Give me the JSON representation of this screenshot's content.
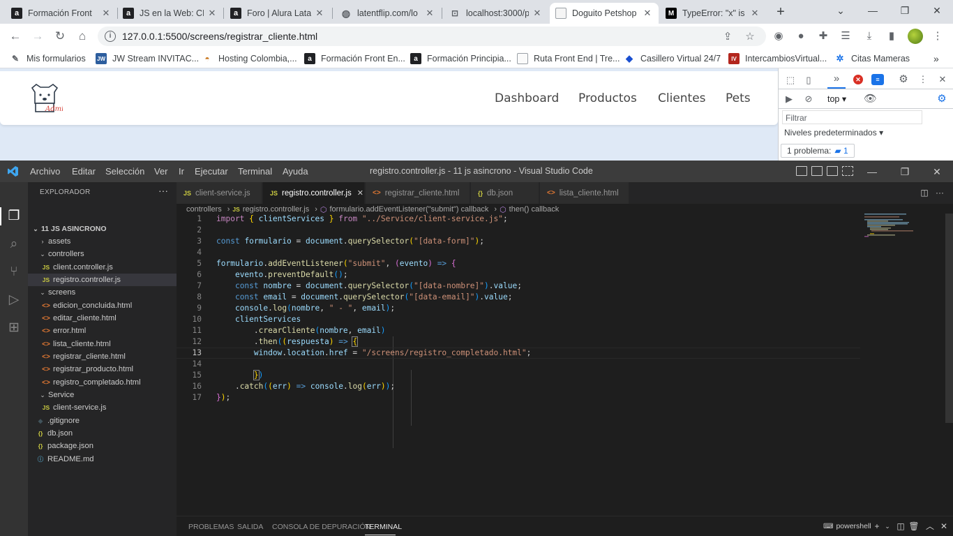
{
  "browser": {
    "tabs": [
      {
        "title": "Formación Front",
        "favicon": "alura-icon"
      },
      {
        "title": "JS en la Web: CRU",
        "favicon": "alura-icon"
      },
      {
        "title": "Foro | Alura Latar",
        "favicon": "alura-icon"
      },
      {
        "title": "latentflip.com/lo",
        "favicon": "globe-icon"
      },
      {
        "title": "localhost:3000/p",
        "favicon": "server-icon"
      },
      {
        "title": "Doguito Petshop",
        "favicon": "page-icon"
      },
      {
        "title": "TypeError: \"x\" is r",
        "favicon": "mdn-icon"
      }
    ],
    "active_tab_index": 5,
    "url": "127.0.0.1:5500/screens/registrar_cliente.html",
    "bookmarks": [
      {
        "label": "Mis formularios",
        "icon": "edit-icon"
      },
      {
        "label": "JW Stream INVITAC...",
        "icon": "jw-icon"
      },
      {
        "label": "Hosting Colombia,...",
        "icon": "hosting-icon"
      },
      {
        "label": "Formación Front En...",
        "icon": "alura-icon"
      },
      {
        "label": "Formación Principia...",
        "icon": "alura-icon"
      },
      {
        "label": "Ruta Front End | Tre...",
        "icon": "page-icon"
      },
      {
        "label": "Casillero Virtual 24/7",
        "icon": "diamond-icon"
      },
      {
        "label": "IntercambiosVirtual...",
        "icon": "iv-icon"
      },
      {
        "label": "Citas Mameras",
        "icon": "molecule-icon"
      }
    ]
  },
  "site": {
    "logo_text": "Admin",
    "nav": [
      "Dashboard",
      "Productos",
      "Clientes",
      "Pets"
    ]
  },
  "devtools": {
    "context": "top",
    "filter_placeholder": "Filtrar",
    "levels": "Niveles predeterminados",
    "problems_label": "1 problema:",
    "problems_count": "1",
    "error_count": "",
    "message_count": ""
  },
  "vscode": {
    "menu": [
      "Archivo",
      "Editar",
      "Selección",
      "Ver",
      "Ir",
      "Ejecutar",
      "Terminal",
      "Ayuda"
    ],
    "window_title": "registro.controller.js - 11 js asincrono - Visual Studio Code",
    "explorer_title": "EXPLORADOR",
    "tree": [
      {
        "label": "11 JS ASINCRONO",
        "kind": "root-open",
        "depth": 0
      },
      {
        "label": "assets",
        "kind": "folder-closed",
        "depth": 1
      },
      {
        "label": "controllers",
        "kind": "folder-open",
        "depth": 1
      },
      {
        "label": "client.controller.js",
        "kind": "js",
        "depth": 2
      },
      {
        "label": "registro.controller.js",
        "kind": "js",
        "depth": 2,
        "selected": true
      },
      {
        "label": "screens",
        "kind": "folder-open",
        "depth": 1
      },
      {
        "label": "edicion_concluida.html",
        "kind": "html",
        "depth": 2
      },
      {
        "label": "editar_cliente.html",
        "kind": "html",
        "depth": 2
      },
      {
        "label": "error.html",
        "kind": "html",
        "depth": 2
      },
      {
        "label": "lista_cliente.html",
        "kind": "html",
        "depth": 2
      },
      {
        "label": "registrar_cliente.html",
        "kind": "html",
        "depth": 2
      },
      {
        "label": "registrar_producto.html",
        "kind": "html",
        "depth": 2
      },
      {
        "label": "registro_completado.html",
        "kind": "html",
        "depth": 2
      },
      {
        "label": "Service",
        "kind": "folder-open",
        "depth": 1
      },
      {
        "label": "client-service.js",
        "kind": "js",
        "depth": 2
      },
      {
        "label": ".gitignore",
        "kind": "git",
        "depth": 1
      },
      {
        "label": "db.json",
        "kind": "json",
        "depth": 1
      },
      {
        "label": "package.json",
        "kind": "json",
        "depth": 1
      },
      {
        "label": "README.md",
        "kind": "md",
        "depth": 1
      }
    ],
    "editor_tabs": [
      {
        "label": "client-service.js",
        "kind": "js"
      },
      {
        "label": "registro.controller.js",
        "kind": "js",
        "active": true
      },
      {
        "label": "registrar_cliente.html",
        "kind": "html"
      },
      {
        "label": "db.json",
        "kind": "json"
      },
      {
        "label": "lista_cliente.html",
        "kind": "html"
      }
    ],
    "breadcrumbs": [
      "controllers",
      "registro.controller.js",
      "formulario.addEventListener(\"submit\") callback",
      "then() callback"
    ],
    "current_line": 13,
    "panel_tabs": [
      "PROBLEMAS",
      "SALIDA",
      "CONSOLA DE DEPURACIÓN",
      "TERMINAL"
    ],
    "active_panel_tab": "TERMINAL",
    "terminal_shell": "powershell"
  }
}
